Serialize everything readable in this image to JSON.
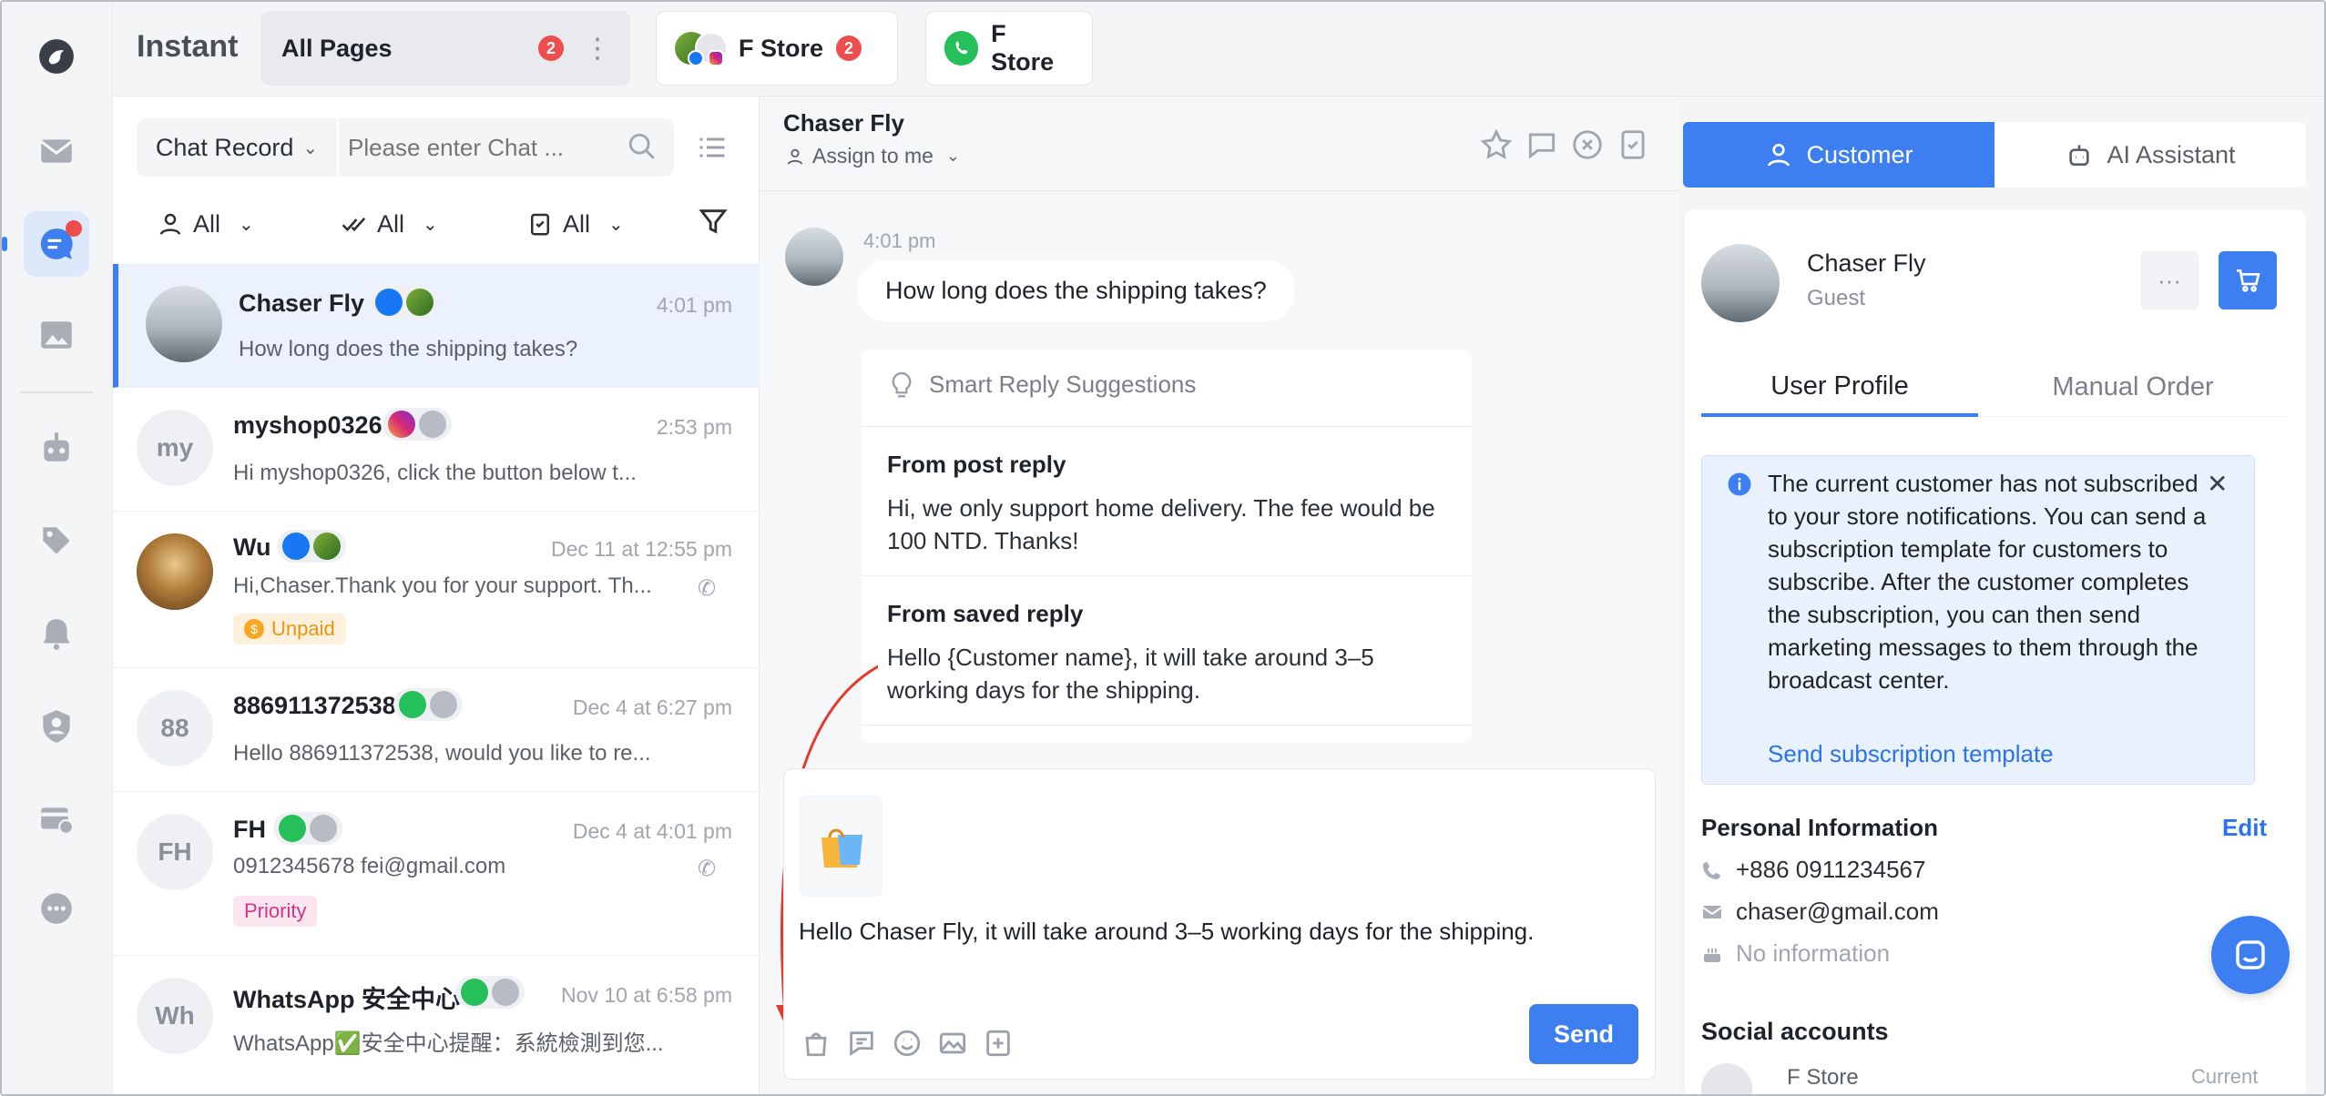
{
  "topbar": {
    "brand": "Instant",
    "tabs": [
      {
        "label": "All Pages",
        "badge": "2"
      },
      {
        "label": "F Store",
        "badge": "2"
      },
      {
        "label": "F Store",
        "badge": ""
      }
    ]
  },
  "list": {
    "search_dropdown": "Chat Record",
    "search_placeholder": "Please enter Chat ...",
    "filters": [
      "All",
      "All",
      "All"
    ],
    "items": [
      {
        "avatar": "",
        "name": "Chaser Fly",
        "time": "4:01 pm",
        "preview": "How long does the shipping takes?",
        "tag": ""
      },
      {
        "avatar": "my",
        "name": "myshop0326",
        "time": "2:53 pm",
        "preview": "Hi myshop0326, click the button below t...",
        "tag": ""
      },
      {
        "avatar": "",
        "name": "Wu",
        "time": "Dec 11 at 12:55 pm",
        "preview": "Hi,Chaser.Thank you for your support. Th...",
        "tag": "Unpaid"
      },
      {
        "avatar": "88",
        "name": "886911372538",
        "time": "Dec 4 at 6:27 pm",
        "preview": "Hello 886911372538, would you like to re...",
        "tag": ""
      },
      {
        "avatar": "FH",
        "name": "FH",
        "time": "Dec 4 at 4:01 pm",
        "preview": "0912345678 fei@gmail.com",
        "tag": "Priority"
      },
      {
        "avatar": "Wh",
        "name": "WhatsApp 安全中心",
        "time": "Nov 10 at 6:58 pm",
        "preview": "WhatsApp✅安全中心提醒：系統檢測到您...",
        "tag": ""
      }
    ]
  },
  "chat": {
    "name": "Chaser Fly",
    "assign": "Assign to me",
    "msg_time": "4:01 pm",
    "msg": "How long does the shipping takes?",
    "smart_title": "Smart Reply Suggestions",
    "suggestions": [
      {
        "title": "From post reply",
        "body": "Hi, we only support home delivery. The fee would be 100 NTD. Thanks!"
      },
      {
        "title": "From saved reply",
        "body": "Hello {Customer name}, it will take around 3–5 working days for the shipping."
      }
    ],
    "composer_text": "Hello Chaser Fly, it will take around 3–5 working days for the shipping.",
    "send": "Send"
  },
  "right": {
    "tab_customer": "Customer",
    "tab_ai": "AI Assistant",
    "customer_name": "Chaser Fly",
    "customer_role": "Guest",
    "subtab_profile": "User Profile",
    "subtab_order": "Manual Order",
    "notice": "The current customer has not subscribed to your store notifications. You can send a subscription template for customers to subscribe. After the customer completes the subscription, you can then send marketing messages to them through the broadcast center.",
    "notice_link": "Send subscription template",
    "personal_title": "Personal Information",
    "edit": "Edit",
    "phone": "+886 0911234567",
    "email": "chaser@gmail.com",
    "birthday": "No information",
    "social_title": "Social accounts",
    "social_partial": "F Store",
    "social_status": "Current"
  },
  "colors": {
    "accent": "#3d7ff0",
    "badge": "#ee4d4d",
    "unpaid": "#f5a623",
    "priority": "#d63384"
  }
}
